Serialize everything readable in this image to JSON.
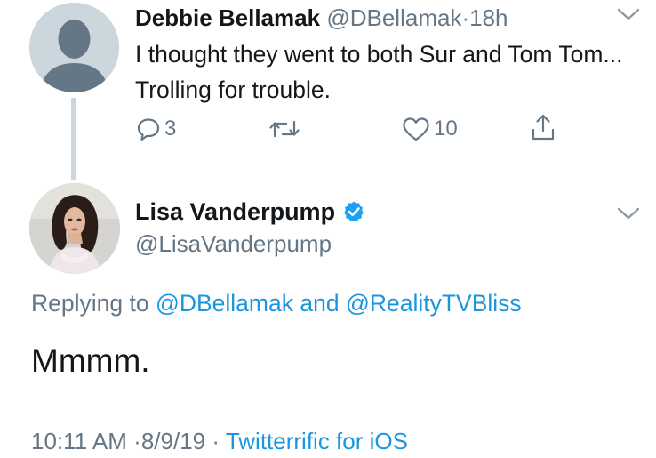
{
  "parent_tweet": {
    "display_name": "Debbie Bellamak",
    "handle": "@DBellamak",
    "separator": "·",
    "age": "18h",
    "text": "I thought they went to both Sur and Tom Tom...  Trolling for trouble.",
    "reply_count": "3",
    "retweet_count": "",
    "like_count": "10",
    "avatar": "default-avatar-icon"
  },
  "main_tweet": {
    "display_name": "Lisa Vanderpump",
    "handle": "@LisaVanderpump",
    "verified": true,
    "replying_prefix": "Replying to",
    "replying_user_1": "@DBellamak",
    "replying_and": "and",
    "replying_user_2": "@RealityTVBliss",
    "text": "Mmmm.",
    "time": "10:11 AM",
    "date": "8/9/19",
    "separator": "·",
    "source": "Twitterrific for iOS"
  },
  "colors": {
    "text": "#14171a",
    "muted": "#657786",
    "link": "#1b95e0",
    "avatar_placeholder": "#ccd6dd"
  }
}
